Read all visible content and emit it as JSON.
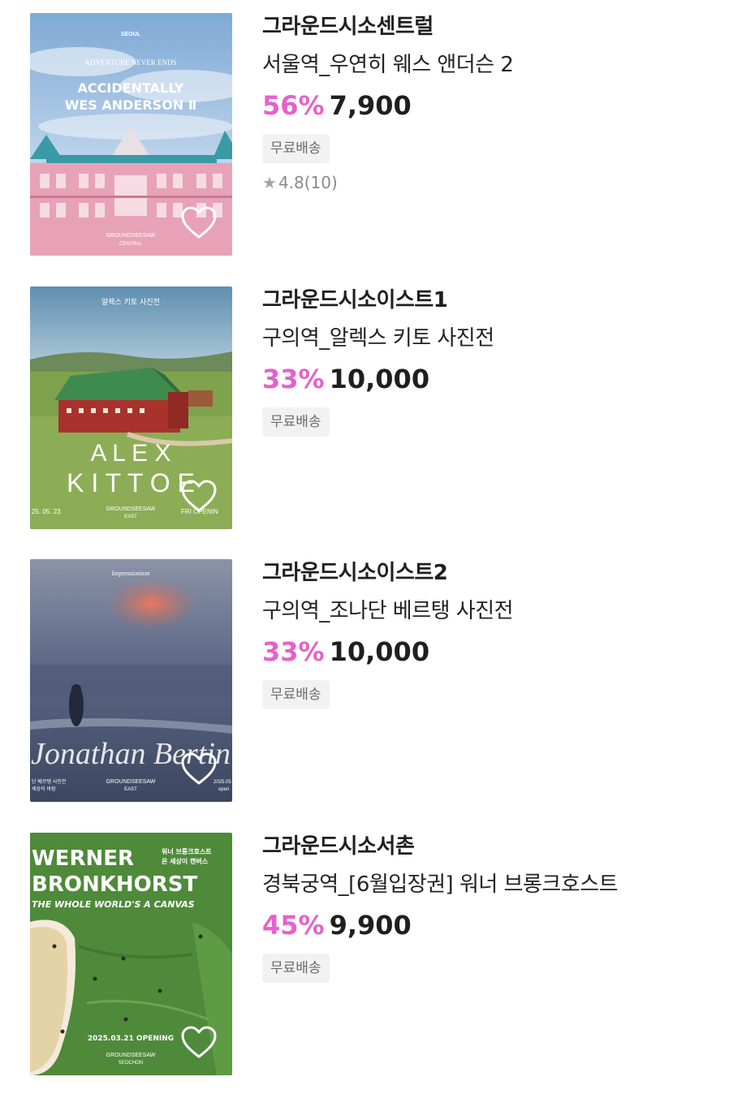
{
  "items": [
    {
      "seller": "그라운드시소센트럴",
      "title": "서울역_우연히 웨스 앤더슨 2",
      "discount": "56%",
      "price": "7,900",
      "badge": "무료배송",
      "rating": "4.8",
      "review_count": "(10)",
      "poster": {
        "top_label": "SEOUL",
        "arc_text": "ADVENTURE NEVER ENDS",
        "line1": "ACCIDENTALLY",
        "line2": "WES ANDERSON Ⅱ",
        "venue": "GROUNDSEESAW",
        "venue_sub": "CENTRAL"
      }
    },
    {
      "seller": "그라운드시소이스트1",
      "title": "구의역_알렉스 키토 사진전",
      "discount": "33%",
      "price": "10,000",
      "badge": "무료배송",
      "poster": {
        "top_label": "알렉스  키토  사진전",
        "line1": "A  L  E  X",
        "line2": "K I T T O E",
        "date": "25. 05. 23",
        "venue": "GROUNDSEESAW",
        "venue_sub": "EAST",
        "right": "FRI  OPENIN"
      }
    },
    {
      "seller": "그라운드시소이스트2",
      "title": "구의역_조나단 베르탱 사진전",
      "discount": "33%",
      "price": "10,000",
      "badge": "무료배송",
      "poster": {
        "top_label": "Impressionism",
        "line1": "Jonathan Bertin",
        "left1": "단 베르탱 사진전",
        "left2": "세상의 바람",
        "venue": "GROUNDSEESAW",
        "venue_sub": "EAST",
        "right1": "2025.05",
        "right2": "open"
      }
    },
    {
      "seller": "그라운드시소서촌",
      "title": "경북궁역_[6월입장권] 워너 브롱크호스트",
      "discount": "45%",
      "price": "9,900",
      "badge": "무료배송",
      "poster": {
        "line1": "WERNER",
        "line2": "BRONKHORST",
        "ko1": "워너 브롱크호스트",
        "ko2": "온 세상이 캔버스",
        "line3": "THE WHOLE WORLD'S A CANVAS",
        "opening": "2025.03.21 OPENING",
        "venue": "GROUNDSEESAW",
        "venue_sub": "SEOCHON"
      }
    }
  ],
  "icons": {
    "favorite": "heart-outline-icon",
    "rating": "star-icon"
  },
  "colors": {
    "discount": "#e661c9",
    "badge_bg": "#f2f2f2",
    "badge_text": "#6b6b6b"
  }
}
